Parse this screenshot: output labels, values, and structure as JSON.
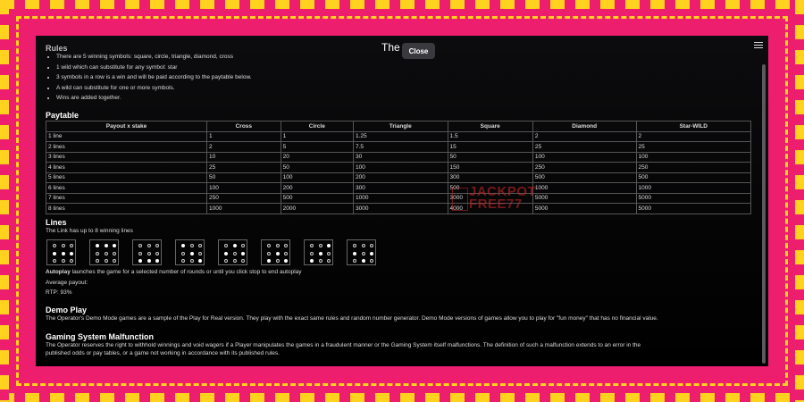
{
  "window": {
    "title": "The Link",
    "close_label": "Close"
  },
  "rules": {
    "heading": "Rules",
    "bullets": [
      "There are 5 winning symbols: square, circle, triangle, diamond, cross",
      "1 wild which can substitute for any symbol: star",
      "3 symbols in a row is a win and will be paid according to the paytable below.",
      "A wild can substitute for one or more symbols.",
      "Wins are added together."
    ]
  },
  "paytable": {
    "heading": "Paytable",
    "columns": [
      "Payout x stake",
      "Cross",
      "Circle",
      "Triangle",
      "Square",
      "Diamond",
      "Star-WILD"
    ],
    "rows": [
      [
        "1 line",
        "1",
        "1",
        "1.25",
        "1.5",
        "2",
        "2"
      ],
      [
        "2 lines",
        "2",
        "5",
        "7.5",
        "15",
        "25",
        "25"
      ],
      [
        "3 lines",
        "10",
        "20",
        "30",
        "50",
        "100",
        "100"
      ],
      [
        "4 lines",
        "25",
        "50",
        "100",
        "150",
        "250",
        "250"
      ],
      [
        "5 lines",
        "50",
        "100",
        "200",
        "300",
        "500",
        "500"
      ],
      [
        "6 lines",
        "100",
        "200",
        "300",
        "500",
        "1000",
        "1000"
      ],
      [
        "7 lines",
        "250",
        "500",
        "1000",
        "3000",
        "5000",
        "5000"
      ],
      [
        "8 lines",
        "1000",
        "2000",
        "3000",
        "4000",
        "5000",
        "5000"
      ]
    ]
  },
  "lines": {
    "heading": "Lines",
    "subtitle": "The Link has up to 8 winning lines",
    "patterns": [
      [
        [
          0,
          0,
          0
        ],
        [
          1,
          1,
          1
        ],
        [
          0,
          0,
          0
        ]
      ],
      [
        [
          1,
          1,
          1
        ],
        [
          0,
          0,
          0
        ],
        [
          0,
          0,
          0
        ]
      ],
      [
        [
          0,
          0,
          0
        ],
        [
          0,
          0,
          0
        ],
        [
          1,
          1,
          1
        ]
      ],
      [
        [
          1,
          0,
          0
        ],
        [
          0,
          1,
          0
        ],
        [
          0,
          0,
          1
        ]
      ],
      [
        [
          0,
          1,
          0
        ],
        [
          1,
          0,
          1
        ],
        [
          0,
          0,
          0
        ]
      ],
      [
        [
          0,
          0,
          0
        ],
        [
          0,
          1,
          0
        ],
        [
          1,
          0,
          1
        ]
      ],
      [
        [
          0,
          0,
          1
        ],
        [
          0,
          1,
          0
        ],
        [
          1,
          0,
          0
        ]
      ],
      [
        [
          0,
          0,
          0
        ],
        [
          1,
          0,
          1
        ],
        [
          0,
          1,
          0
        ]
      ]
    ],
    "autoplay_bold": "Autoplay",
    "autoplay_text": " launches the game for a selected number of rounds or until you click stop to end autoplay",
    "average_payout": "Average payout:",
    "rtp": "RTP: 93%"
  },
  "demo": {
    "heading": "Demo Play",
    "text": "The Operator's Demo Mode games are a sample of the Play for Real version. They play with the exact same rules and random number generator. Demo Mode versions of games allow you to play for \"fun money\" that has no financial value."
  },
  "malfunction": {
    "heading": "Gaming System Malfunction",
    "line1": "The Operator reserves the right to withhold winnings and void wagers if a Player manipulates the games in a fraudulent manner or the Gaming System itself malfunctions. The definition of such a malfunction extends to an error in the",
    "line2": "published odds or pay tables, or a game not working in accordance with its published rules."
  },
  "watermark": {
    "line1": "JACKPOT",
    "line2": "FREE77"
  },
  "colors": {
    "background": "#ee1e6e",
    "stripe": "#ffd21f",
    "panel": "#000000"
  }
}
